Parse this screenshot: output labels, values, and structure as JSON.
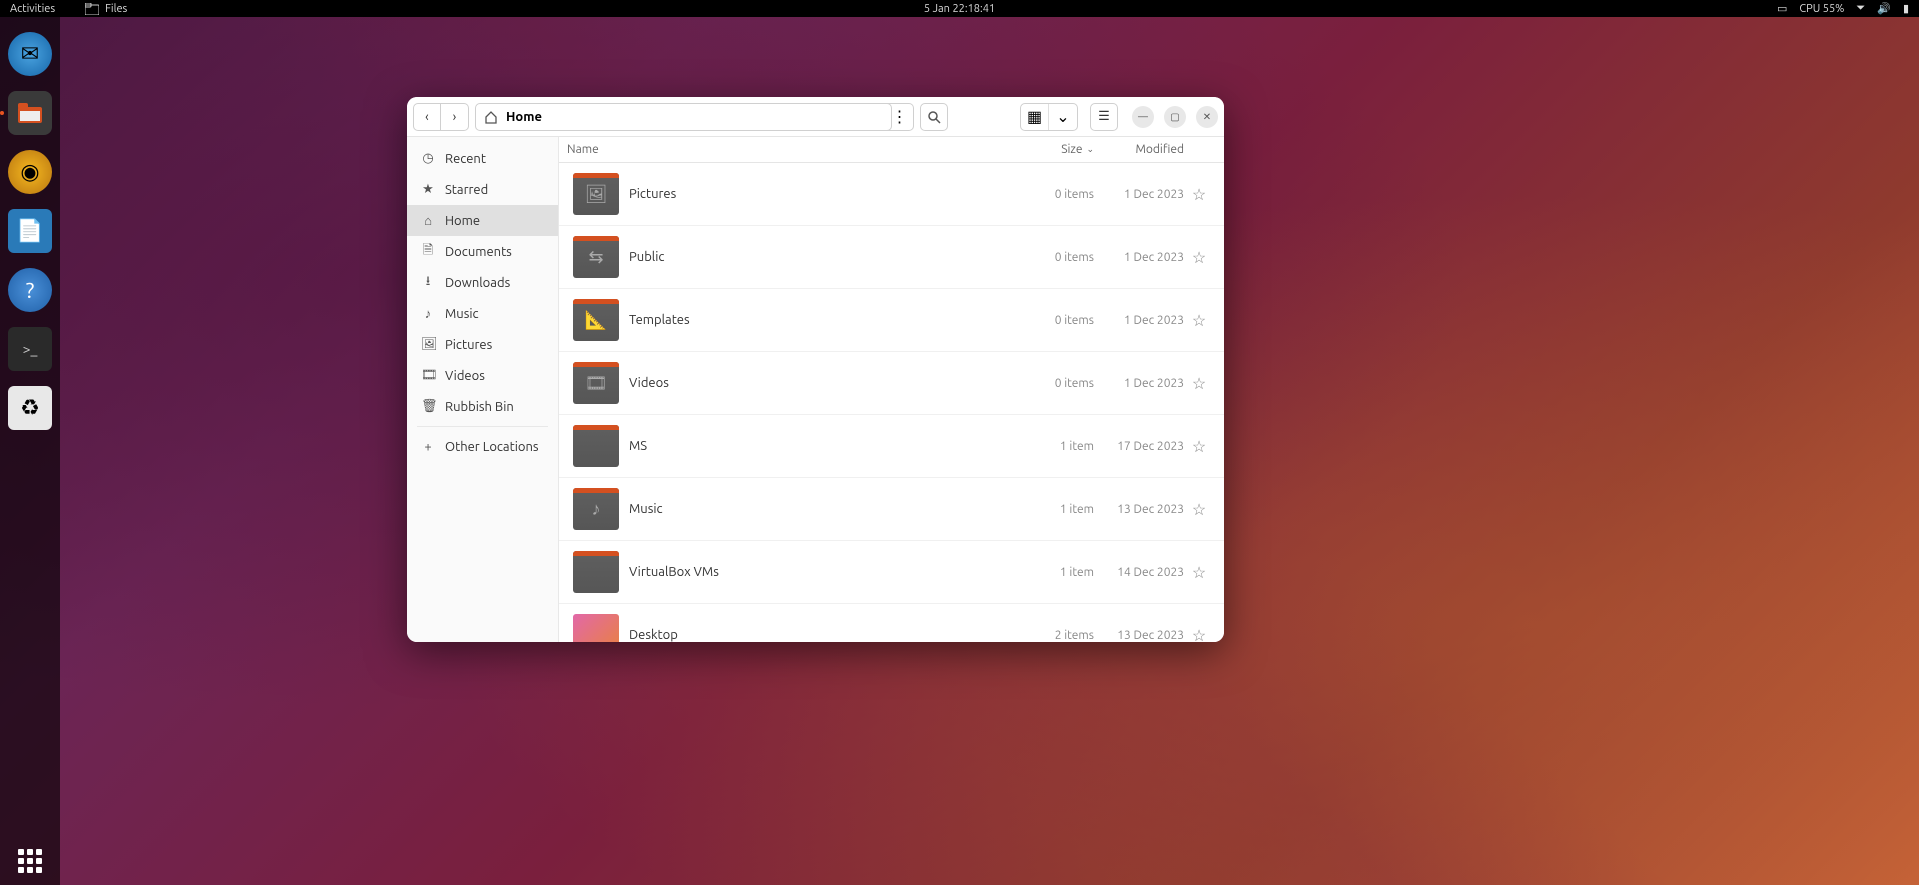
{
  "topbar": {
    "activities": "Activities",
    "files": "Files",
    "datetime": "5 Jan  22:18:41",
    "cpu": "CPU 55%"
  },
  "window": {
    "path_label": "Home",
    "columns": {
      "name": "Name",
      "size": "Size",
      "modified": "Modified"
    }
  },
  "sidebar": [
    {
      "icon": "clock",
      "label": "Recent"
    },
    {
      "icon": "star",
      "label": "Starred"
    },
    {
      "icon": "home",
      "label": "Home",
      "selected": true
    },
    {
      "icon": "doc",
      "label": "Documents"
    },
    {
      "icon": "down",
      "label": "Downloads"
    },
    {
      "icon": "music",
      "label": "Music"
    },
    {
      "icon": "pic",
      "label": "Pictures"
    },
    {
      "icon": "vid",
      "label": "Videos"
    },
    {
      "icon": "trash",
      "label": "Rubbish Bin"
    }
  ],
  "other_locations": "Other Locations",
  "files": [
    {
      "name": "Pictures",
      "size": "0 items",
      "modified": "1 Dec 2023",
      "glyph": "🖼"
    },
    {
      "name": "Public",
      "size": "0 items",
      "modified": "1 Dec 2023",
      "glyph": "⇆"
    },
    {
      "name": "Templates",
      "size": "0 items",
      "modified": "1 Dec 2023",
      "glyph": "📐"
    },
    {
      "name": "Videos",
      "size": "0 items",
      "modified": "1 Dec 2023",
      "glyph": "🎞"
    },
    {
      "name": "MS",
      "size": "1 item",
      "modified": "17 Dec 2023",
      "glyph": ""
    },
    {
      "name": "Music",
      "size": "1 item",
      "modified": "13 Dec 2023",
      "glyph": "♪"
    },
    {
      "name": "VirtualBox VMs",
      "size": "1 item",
      "modified": "14 Dec 2023",
      "glyph": ""
    },
    {
      "name": "Desktop",
      "size": "2 items",
      "modified": "13 Dec 2023",
      "glyph": "",
      "desktop": true
    }
  ]
}
